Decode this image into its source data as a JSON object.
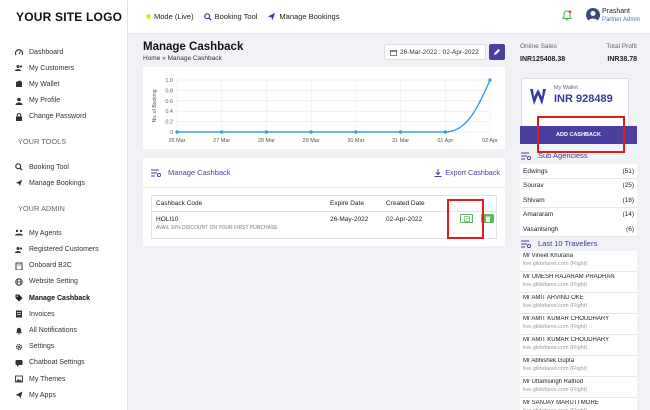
{
  "logo": "YOUR SITE LOGO",
  "topbar": {
    "mode": "Mode (Live)",
    "booking_tool": "Booking Tool",
    "manage_bookings": "Manage Bookings",
    "user_name": "Prashant",
    "user_role": "Partner Admin"
  },
  "sidebar": {
    "main_items": [
      {
        "label": "Dashboard",
        "icon": "dashboard-icon"
      },
      {
        "label": "My Customers",
        "icon": "users-icon"
      },
      {
        "label": "My Wallet",
        "icon": "wallet-icon"
      },
      {
        "label": "My Profile",
        "icon": "user-icon"
      },
      {
        "label": "Change Password",
        "icon": "lock-icon"
      }
    ],
    "tools_title": "YOUR TOOLS",
    "tools_items": [
      {
        "label": "Booking Tool",
        "icon": "search-icon"
      },
      {
        "label": "Manage Bookings",
        "icon": "plane-icon"
      }
    ],
    "admin_title": "YOUR ADMIN",
    "admin_items": [
      {
        "label": "My Agents",
        "icon": "agents-icon"
      },
      {
        "label": "Registered Customers",
        "icon": "users-icon"
      },
      {
        "label": "Onboard B2C",
        "icon": "building-icon"
      },
      {
        "label": "Website Setting",
        "icon": "globe-icon"
      },
      {
        "label": "Manage Cashback",
        "icon": "tags-icon"
      },
      {
        "label": "Invoices",
        "icon": "invoice-icon"
      },
      {
        "label": "All Notifications",
        "icon": "bell-icon"
      },
      {
        "label": "Settings",
        "icon": "gear-icon"
      },
      {
        "label": "Chatboat Settings",
        "icon": "chat-icon"
      },
      {
        "label": "My Themes",
        "icon": "image-icon"
      },
      {
        "label": "My Apps",
        "icon": "send-icon"
      }
    ]
  },
  "main": {
    "title": "Manage Cashback",
    "breadcrumb": "Home » Manage Cashback",
    "date_range": "26-Mar-2022 : 02-Apr-2022",
    "table_title": "Manage Cashback",
    "export_label": "Export Cashback",
    "columns": [
      "Cashback Code",
      "Expire Date",
      "Created Date"
    ],
    "rows": [
      {
        "code": "HOLI10",
        "description": "AVAIL 10% DISCOUNT ON YOUR FIRST PURCHASE",
        "expire": "26-May-2022",
        "created": "02-Apr-2022"
      }
    ]
  },
  "chart_data": {
    "type": "line",
    "categories": [
      "26 Mar",
      "27 Mar",
      "28 Mar",
      "29 Mar",
      "30 Mar",
      "31 Mar",
      "01 Apr",
      "02 Apr"
    ],
    "values": [
      0,
      0,
      0,
      0,
      0,
      0,
      0,
      1
    ],
    "ylabel": "No. of Booking",
    "ylim": [
      0,
      1.0
    ],
    "yticks": [
      "0",
      "0.2",
      "0.4",
      "0.6",
      "0.8",
      "1.0"
    ],
    "grid": true,
    "color": "#3b9ddd"
  },
  "right": {
    "online_sales_label": "Online Sales",
    "online_sales_value": "INR125408.38",
    "total_profit_label": "Total Profit",
    "total_profit_value": "INR38.78",
    "wallet_label": "My Wallet",
    "wallet_amount": "INR 928489",
    "add_cashback": "ADD CASHBACK",
    "sub_agencies_title": "Sub Agenciess",
    "agencies": [
      {
        "name": "Edwings",
        "count": "(51)"
      },
      {
        "name": "Sourav",
        "count": "(25)"
      },
      {
        "name": "Shivam",
        "count": "(18)"
      },
      {
        "name": "Amararam",
        "count": "(14)"
      },
      {
        "name": "Vasantsingh",
        "count": "(6)"
      }
    ],
    "travellers_title": "Last 10 Travellers",
    "travellers": [
      {
        "name": "Mr Vineet Khurana",
        "source": "live.glidefares.com (Flight)"
      },
      {
        "name": "Mr UMESH RAJARAM PRADHAN",
        "source": "live.glidefares.com (Flight)"
      },
      {
        "name": "Mr AMIT ARVIND OKE",
        "source": "live.glidefares.com (Flight)"
      },
      {
        "name": "Mr AMIT KUMAR CHOUDHARY",
        "source": "live.glidefares.com (Flight)"
      },
      {
        "name": "Mr AMIT KUMAR CHOUDHARY",
        "source": "live.glidefares.com (Flight)"
      },
      {
        "name": "Mr Abhishek Gupta",
        "source": "live.glidefares.com (Flight)"
      },
      {
        "name": "Mr Uttamsingh Rathod",
        "source": "live.glidefares.com (Flight)"
      },
      {
        "name": "Mr SANJAY MARUTI MORE",
        "source": "live.glidefares.com (Flight)"
      }
    ]
  },
  "colors": {
    "accent": "#4a3f9e",
    "highlight": "#e21b1b",
    "line": "#3b9ddd"
  }
}
